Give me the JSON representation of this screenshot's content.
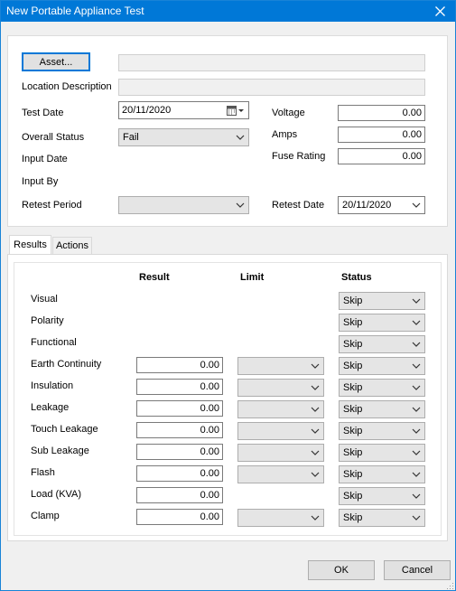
{
  "window": {
    "title": "New Portable Appliance Test"
  },
  "form": {
    "asset_button": "Asset...",
    "location_label": "Location Description",
    "test_date_label": "Test Date",
    "test_date_value": "20/11/2020",
    "overall_status_label": "Overall Status",
    "overall_status_value": "Fail",
    "input_date_label": "Input Date",
    "input_by_label": "Input By",
    "retest_period_label": "Retest Period",
    "retest_period_value": "",
    "voltage_label": "Voltage",
    "voltage_value": "0.00",
    "amps_label": "Amps",
    "amps_value": "0.00",
    "fuse_label": "Fuse Rating",
    "fuse_value": "0.00",
    "retest_date_label": "Retest Date",
    "retest_date_value": "20/11/2020"
  },
  "tabs": [
    {
      "label": "Results"
    },
    {
      "label": "Actions"
    }
  ],
  "results": {
    "headers": {
      "result": "Result",
      "limit": "Limit",
      "status": "Status"
    },
    "rows": [
      {
        "name": "Visual",
        "result": null,
        "limit": false,
        "status": "Skip"
      },
      {
        "name": "Polarity",
        "result": null,
        "limit": false,
        "status": "Skip"
      },
      {
        "name": "Functional",
        "result": null,
        "limit": false,
        "status": "Skip"
      },
      {
        "name": "Earth Continuity",
        "result": "0.00",
        "limit": true,
        "status": "Skip"
      },
      {
        "name": "Insulation",
        "result": "0.00",
        "limit": true,
        "status": "Skip"
      },
      {
        "name": "Leakage",
        "result": "0.00",
        "limit": true,
        "status": "Skip"
      },
      {
        "name": "Touch Leakage",
        "result": "0.00",
        "limit": true,
        "status": "Skip"
      },
      {
        "name": "Sub Leakage",
        "result": "0.00",
        "limit": true,
        "status": "Skip"
      },
      {
        "name": "Flash",
        "result": "0.00",
        "limit": true,
        "status": "Skip"
      },
      {
        "name": "Load (KVA)",
        "result": "0.00",
        "limit": false,
        "status": "Skip"
      },
      {
        "name": "Clamp",
        "result": "0.00",
        "limit": true,
        "status": "Skip"
      }
    ]
  },
  "footer": {
    "ok": "OK",
    "cancel": "Cancel"
  },
  "colors": {
    "titlebar": "#0078d7",
    "focus": "#0078d7"
  }
}
